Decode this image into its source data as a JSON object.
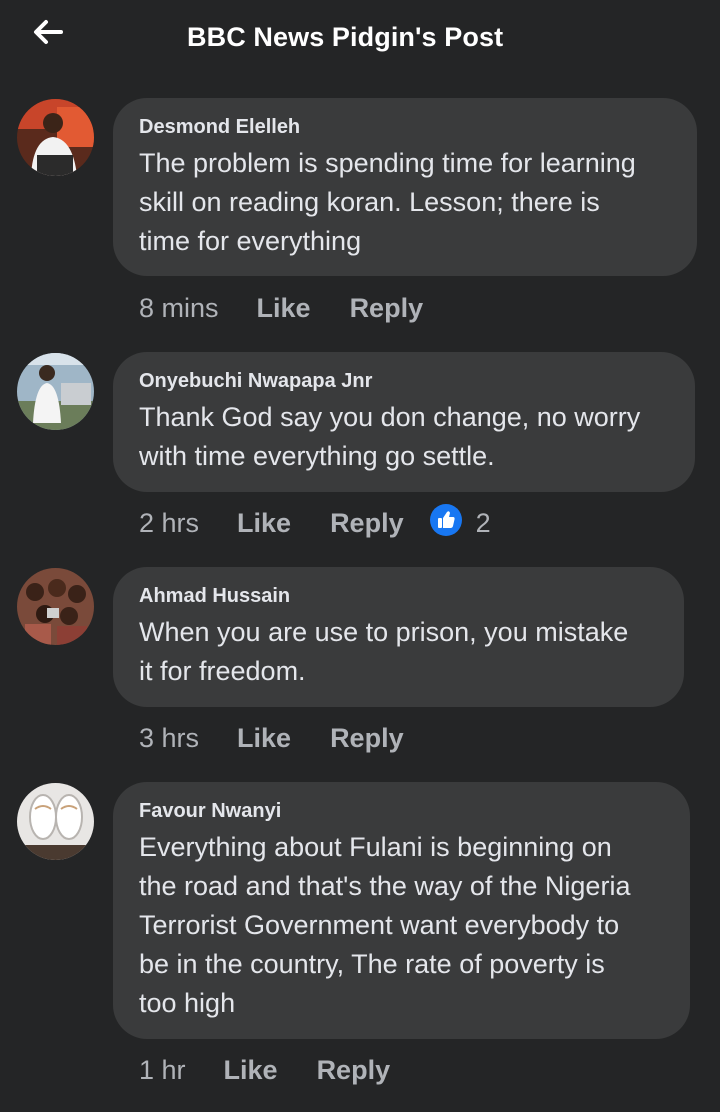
{
  "header": {
    "title": "BBC News Pidgin's Post",
    "back_icon": "arrow-left-icon"
  },
  "colors": {
    "background": "#242526",
    "bubble": "#3a3b3c",
    "text": "#e4e6eb",
    "secondary_text": "#b0b3b8",
    "like_reaction": "#1877f2"
  },
  "comments": [
    {
      "author": "Desmond Elelleh",
      "text": "The problem is spending time for learning\nskill on reading koran. Lesson; there is\ntime for everything",
      "time": "8 mins",
      "like_label": "Like",
      "reply_label": "Reply"
    },
    {
      "author": "Onyebuchi Nwapapa Jnr",
      "text": "Thank God say you don change, no worry\nwith time everything go settle.",
      "time": "2 hrs",
      "like_label": "Like",
      "reply_label": "Reply",
      "reaction_icon": "thumbs-up-icon",
      "reaction_count": "2"
    },
    {
      "author": "Ahmad Hussain",
      "text": "When you are use to prison, you mistake\nit for freedom.",
      "time": "3 hrs",
      "like_label": "Like",
      "reply_label": "Reply"
    },
    {
      "author": "Favour Nwanyi",
      "text": "Everything about Fulani is beginning on\nthe road and that's the way of the Nigeria\nTerrorist Government want everybody to\nbe in the country, The rate of poverty is\ntoo high",
      "time": "1 hr",
      "like_label": "Like",
      "reply_label": "Reply"
    }
  ]
}
